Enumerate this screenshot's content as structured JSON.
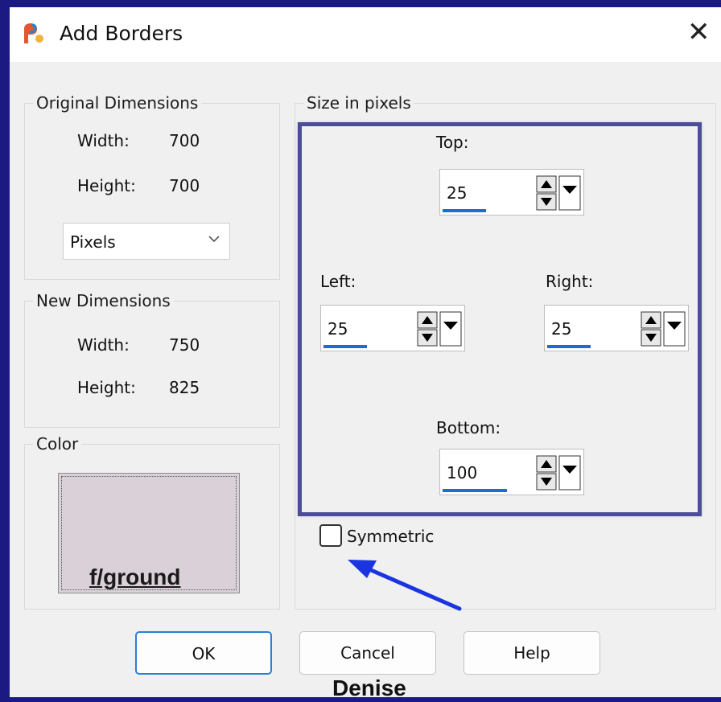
{
  "window": {
    "title": "Add Borders",
    "close_glyph": "✕"
  },
  "original_dimensions": {
    "legend": "Original Dimensions",
    "width_label": "Width:",
    "width_value": "700",
    "height_label": "Height:",
    "height_value": "700",
    "units_value": "Pixels"
  },
  "new_dimensions": {
    "legend": "New Dimensions",
    "width_label": "Width:",
    "width_value": "750",
    "height_label": "Height:",
    "height_value": "825"
  },
  "color": {
    "legend": "Color",
    "swatch_hex": "#dad0d8",
    "swatch_caption": "f/ground"
  },
  "size_in_pixels": {
    "legend": "Size in pixels",
    "top_label": "Top:",
    "top_value": "25",
    "left_label": "Left:",
    "left_value": "25",
    "right_label": "Right:",
    "right_value": "25",
    "bottom_label": "Bottom:",
    "bottom_value": "100",
    "symmetric_label": "Symmetric",
    "symmetric_checked": false
  },
  "buttons": {
    "ok": "OK",
    "cancel": "Cancel",
    "help": "Help"
  },
  "watermark": "Denise",
  "colors": {
    "frame": "#1a1a82",
    "highlight": "#4b4d9b",
    "arrow": "#1a35e0",
    "focus_underline": "#1a6ed1"
  },
  "icons": [
    "app-icon",
    "close-icon",
    "chevron-down-icon",
    "spin-up-icon",
    "spin-down-icon",
    "dropdown-arrow-icon",
    "annotation-arrow-icon"
  ]
}
